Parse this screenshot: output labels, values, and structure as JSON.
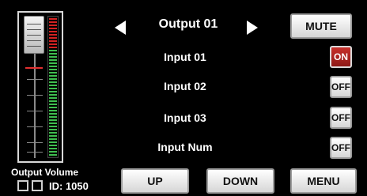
{
  "output": {
    "title": "Output 01"
  },
  "mute_label": "MUTE",
  "inputs": [
    {
      "label": "Input 01",
      "state": "ON"
    },
    {
      "label": "Input 02",
      "state": "OFF"
    },
    {
      "label": "Input 03",
      "state": "OFF"
    },
    {
      "label": "Input Num",
      "state": "OFF"
    }
  ],
  "volume": {
    "label": "Output Volume"
  },
  "device": {
    "id_text": "ID: 1050"
  },
  "bottom_buttons": {
    "up": "UP",
    "down": "DOWN",
    "menu": "MENU"
  },
  "colors": {
    "on": "#c7302b",
    "meter_green": "#3fbf4f",
    "meter_red": "#d32222"
  }
}
